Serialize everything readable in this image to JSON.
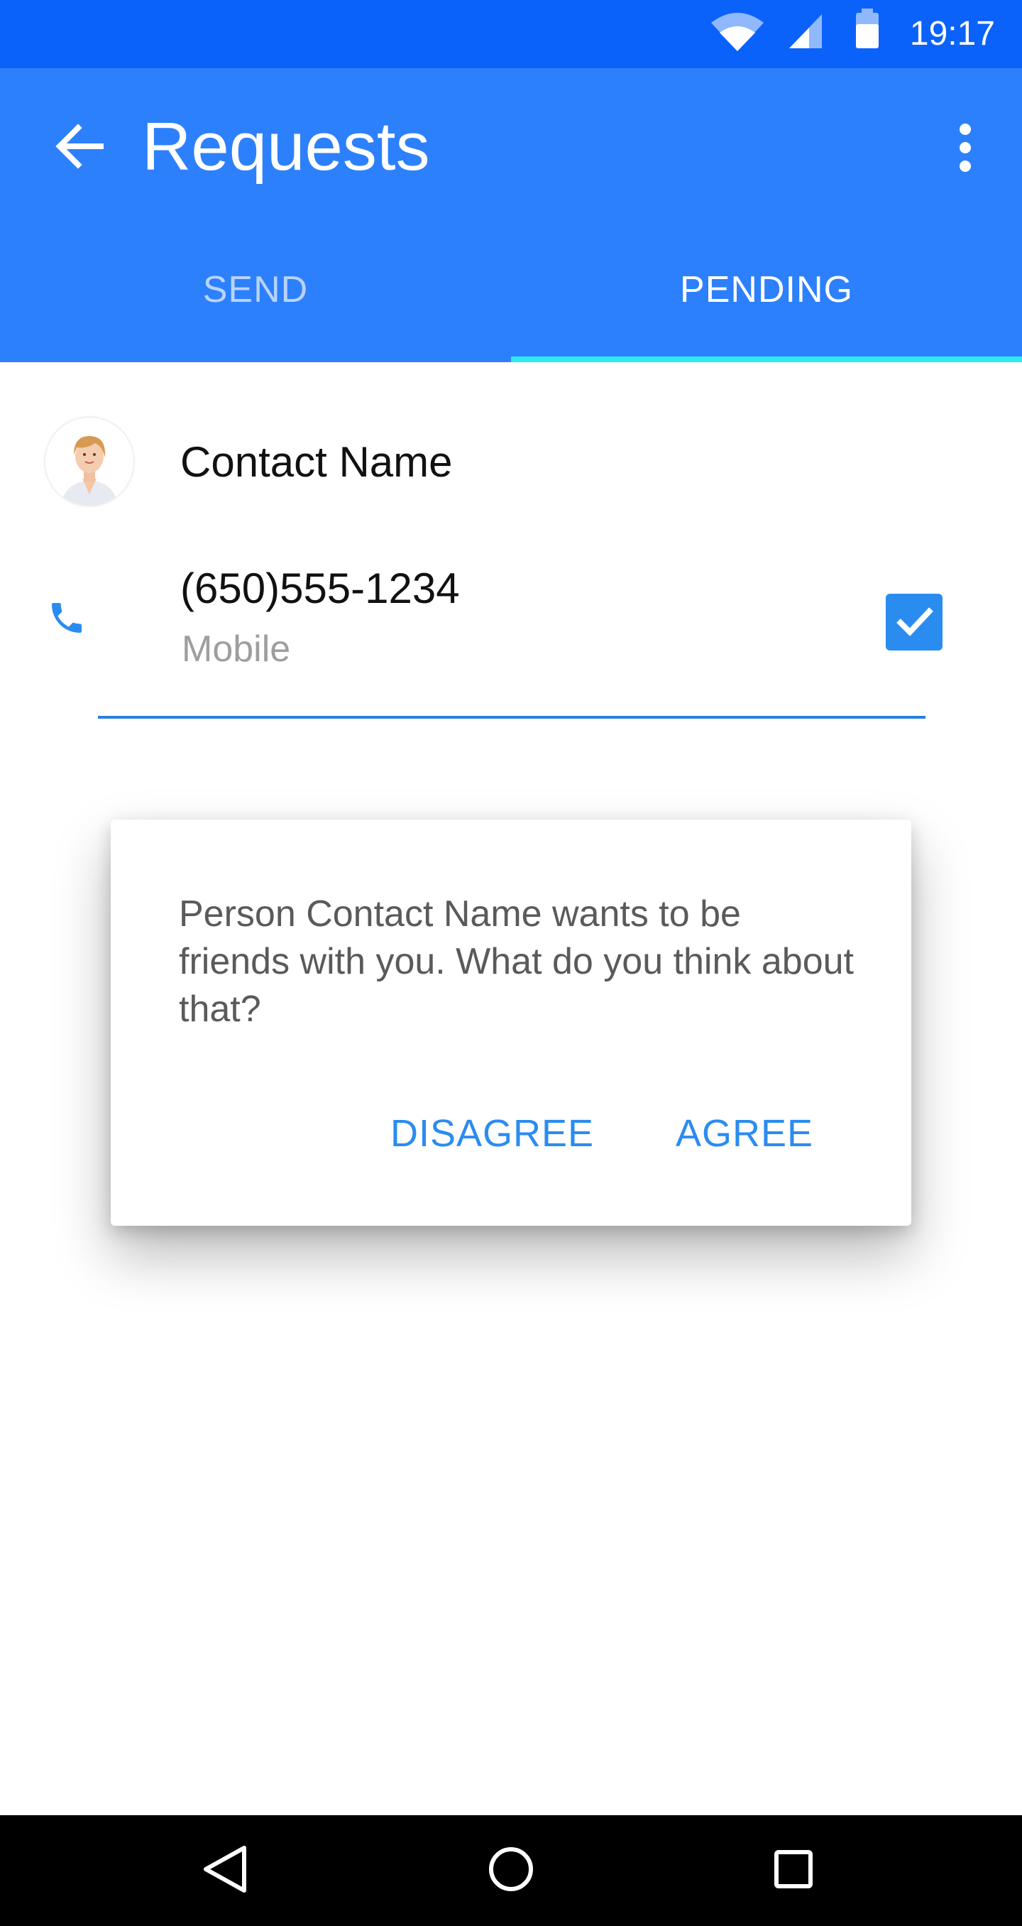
{
  "status_bar": {
    "time": "19:17",
    "icons": [
      "wifi-icon",
      "cell-signal-icon",
      "battery-icon"
    ]
  },
  "app_bar": {
    "title": "Requests",
    "back_icon": "arrow-back-icon",
    "menu_icon": "more-vert-icon"
  },
  "tabs": [
    {
      "label": "SEND",
      "active": false
    },
    {
      "label": "PENDING",
      "active": true
    }
  ],
  "contact": {
    "name": "Contact Name",
    "phone": "(650)555-1234",
    "phone_type": "Mobile",
    "selected": true
  },
  "dialog": {
    "message": "Person Contact Name wants to be friends with you. What do you think about that?",
    "disagree_label": "DISAGREE",
    "agree_label": "AGREE"
  },
  "nav_bar": {
    "icons": [
      "nav-back-icon",
      "nav-home-icon",
      "nav-recents-icon"
    ]
  },
  "colors": {
    "status_bar": "#0a62fb",
    "app_bar": "#2d80fb",
    "tab_indicator": "#2de9f5",
    "accent": "#2b8cf0"
  }
}
